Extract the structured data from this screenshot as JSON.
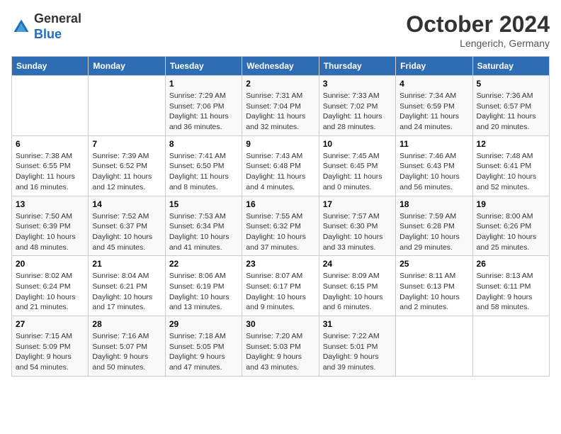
{
  "header": {
    "logo_line1": "General",
    "logo_line2": "Blue",
    "month": "October 2024",
    "location": "Lengerich, Germany"
  },
  "weekdays": [
    "Sunday",
    "Monday",
    "Tuesday",
    "Wednesday",
    "Thursday",
    "Friday",
    "Saturday"
  ],
  "weeks": [
    [
      {
        "day": "",
        "detail": ""
      },
      {
        "day": "",
        "detail": ""
      },
      {
        "day": "1",
        "detail": "Sunrise: 7:29 AM\nSunset: 7:06 PM\nDaylight: 11 hours and 36 minutes."
      },
      {
        "day": "2",
        "detail": "Sunrise: 7:31 AM\nSunset: 7:04 PM\nDaylight: 11 hours and 32 minutes."
      },
      {
        "day": "3",
        "detail": "Sunrise: 7:33 AM\nSunset: 7:02 PM\nDaylight: 11 hours and 28 minutes."
      },
      {
        "day": "4",
        "detail": "Sunrise: 7:34 AM\nSunset: 6:59 PM\nDaylight: 11 hours and 24 minutes."
      },
      {
        "day": "5",
        "detail": "Sunrise: 7:36 AM\nSunset: 6:57 PM\nDaylight: 11 hours and 20 minutes."
      }
    ],
    [
      {
        "day": "6",
        "detail": "Sunrise: 7:38 AM\nSunset: 6:55 PM\nDaylight: 11 hours and 16 minutes."
      },
      {
        "day": "7",
        "detail": "Sunrise: 7:39 AM\nSunset: 6:52 PM\nDaylight: 11 hours and 12 minutes."
      },
      {
        "day": "8",
        "detail": "Sunrise: 7:41 AM\nSunset: 6:50 PM\nDaylight: 11 hours and 8 minutes."
      },
      {
        "day": "9",
        "detail": "Sunrise: 7:43 AM\nSunset: 6:48 PM\nDaylight: 11 hours and 4 minutes."
      },
      {
        "day": "10",
        "detail": "Sunrise: 7:45 AM\nSunset: 6:45 PM\nDaylight: 11 hours and 0 minutes."
      },
      {
        "day": "11",
        "detail": "Sunrise: 7:46 AM\nSunset: 6:43 PM\nDaylight: 10 hours and 56 minutes."
      },
      {
        "day": "12",
        "detail": "Sunrise: 7:48 AM\nSunset: 6:41 PM\nDaylight: 10 hours and 52 minutes."
      }
    ],
    [
      {
        "day": "13",
        "detail": "Sunrise: 7:50 AM\nSunset: 6:39 PM\nDaylight: 10 hours and 48 minutes."
      },
      {
        "day": "14",
        "detail": "Sunrise: 7:52 AM\nSunset: 6:37 PM\nDaylight: 10 hours and 45 minutes."
      },
      {
        "day": "15",
        "detail": "Sunrise: 7:53 AM\nSunset: 6:34 PM\nDaylight: 10 hours and 41 minutes."
      },
      {
        "day": "16",
        "detail": "Sunrise: 7:55 AM\nSunset: 6:32 PM\nDaylight: 10 hours and 37 minutes."
      },
      {
        "day": "17",
        "detail": "Sunrise: 7:57 AM\nSunset: 6:30 PM\nDaylight: 10 hours and 33 minutes."
      },
      {
        "day": "18",
        "detail": "Sunrise: 7:59 AM\nSunset: 6:28 PM\nDaylight: 10 hours and 29 minutes."
      },
      {
        "day": "19",
        "detail": "Sunrise: 8:00 AM\nSunset: 6:26 PM\nDaylight: 10 hours and 25 minutes."
      }
    ],
    [
      {
        "day": "20",
        "detail": "Sunrise: 8:02 AM\nSunset: 6:24 PM\nDaylight: 10 hours and 21 minutes."
      },
      {
        "day": "21",
        "detail": "Sunrise: 8:04 AM\nSunset: 6:21 PM\nDaylight: 10 hours and 17 minutes."
      },
      {
        "day": "22",
        "detail": "Sunrise: 8:06 AM\nSunset: 6:19 PM\nDaylight: 10 hours and 13 minutes."
      },
      {
        "day": "23",
        "detail": "Sunrise: 8:07 AM\nSunset: 6:17 PM\nDaylight: 10 hours and 9 minutes."
      },
      {
        "day": "24",
        "detail": "Sunrise: 8:09 AM\nSunset: 6:15 PM\nDaylight: 10 hours and 6 minutes."
      },
      {
        "day": "25",
        "detail": "Sunrise: 8:11 AM\nSunset: 6:13 PM\nDaylight: 10 hours and 2 minutes."
      },
      {
        "day": "26",
        "detail": "Sunrise: 8:13 AM\nSunset: 6:11 PM\nDaylight: 9 hours and 58 minutes."
      }
    ],
    [
      {
        "day": "27",
        "detail": "Sunrise: 7:15 AM\nSunset: 5:09 PM\nDaylight: 9 hours and 54 minutes."
      },
      {
        "day": "28",
        "detail": "Sunrise: 7:16 AM\nSunset: 5:07 PM\nDaylight: 9 hours and 50 minutes."
      },
      {
        "day": "29",
        "detail": "Sunrise: 7:18 AM\nSunset: 5:05 PM\nDaylight: 9 hours and 47 minutes."
      },
      {
        "day": "30",
        "detail": "Sunrise: 7:20 AM\nSunset: 5:03 PM\nDaylight: 9 hours and 43 minutes."
      },
      {
        "day": "31",
        "detail": "Sunrise: 7:22 AM\nSunset: 5:01 PM\nDaylight: 9 hours and 39 minutes."
      },
      {
        "day": "",
        "detail": ""
      },
      {
        "day": "",
        "detail": ""
      }
    ]
  ]
}
